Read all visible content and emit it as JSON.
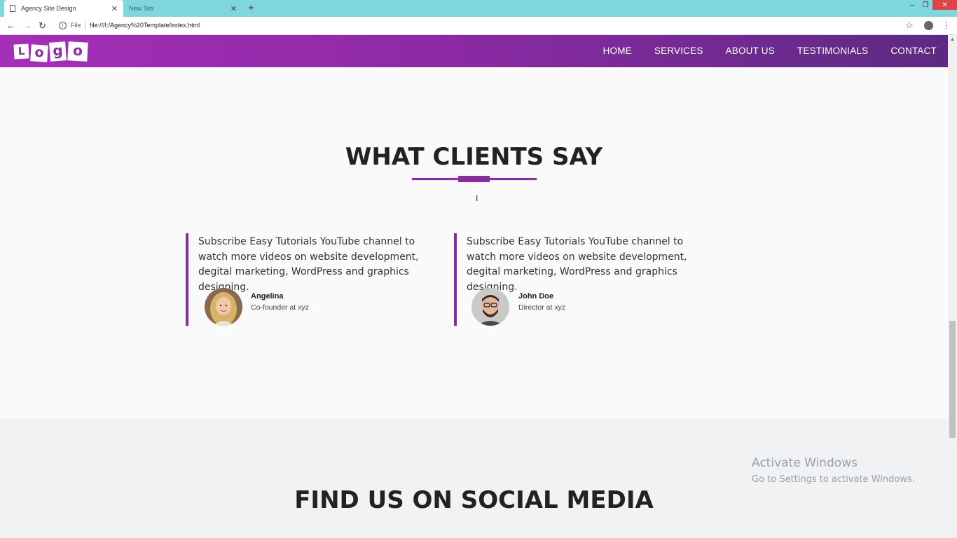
{
  "browser": {
    "tabs": [
      {
        "label": "Agency Site Design",
        "close": "✕"
      },
      {
        "label": "New Tab",
        "close": "✕"
      }
    ],
    "new_tab": "+",
    "file_label": "File",
    "url": "file:///I:/Agency%20Template/index.html",
    "window": {
      "min": "–",
      "max": "❐",
      "close": "✕"
    }
  },
  "header": {
    "logo": [
      "L",
      "o",
      "g",
      "o"
    ],
    "nav": [
      "HOME",
      "SERVICES",
      "ABOUT US",
      "TESTIMONIALS",
      "CONTACT"
    ]
  },
  "testimonials": {
    "title": "WHAT CLIENTS SAY",
    "cards": [
      {
        "quote": "Subscribe Easy Tutorials YouTube channel to watch more videos on website development, degital marketing, WordPress and graphics designing.",
        "name": "Angelina",
        "role": "Co-founder at xyz"
      },
      {
        "quote": "Subscribe Easy Tutorials YouTube channel to watch more videos on website development, degital marketing, WordPress and graphics designing.",
        "name": "John Doe",
        "role": "Director at xyz"
      }
    ]
  },
  "social": {
    "title": "FIND US ON SOCIAL MEDIA"
  },
  "watermark": {
    "line1": "Activate Windows",
    "line2": "Go to Settings to activate Windows."
  },
  "colors": {
    "accent": "#8e2aa6",
    "tabbar": "#7fd6dd"
  }
}
